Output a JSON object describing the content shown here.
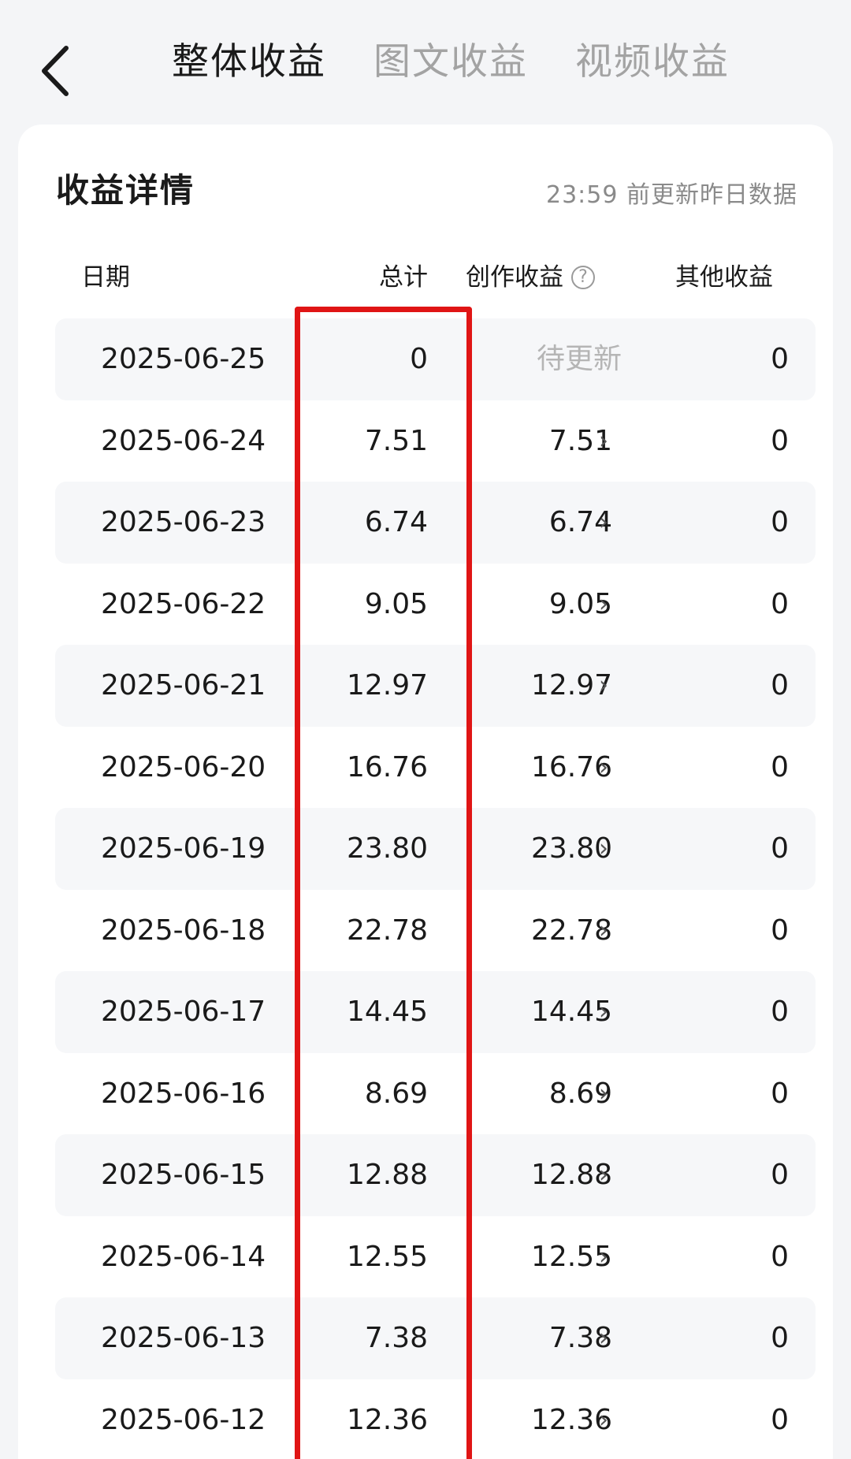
{
  "header": {
    "tabs": [
      {
        "label": "整体收益",
        "active": true
      },
      {
        "label": "图文收益",
        "active": false
      },
      {
        "label": "视频收益",
        "active": false
      }
    ]
  },
  "card": {
    "title": "收益详情",
    "update_note": "23:59 前更新昨日数据",
    "columns": {
      "date": "日期",
      "total": "总计",
      "creation": "创作收益",
      "other": "其他收益"
    },
    "rows": [
      {
        "date": "2025-06-25",
        "total": "0",
        "creation": "待更新",
        "other": "0"
      },
      {
        "date": "2025-06-24",
        "total": "7.51",
        "creation": "7.51",
        "other": "0"
      },
      {
        "date": "2025-06-23",
        "total": "6.74",
        "creation": "6.74",
        "other": "0"
      },
      {
        "date": "2025-06-22",
        "total": "9.05",
        "creation": "9.05",
        "other": "0"
      },
      {
        "date": "2025-06-21",
        "total": "12.97",
        "creation": "12.97",
        "other": "0"
      },
      {
        "date": "2025-06-20",
        "total": "16.76",
        "creation": "16.76",
        "other": "0"
      },
      {
        "date": "2025-06-19",
        "total": "23.80",
        "creation": "23.80",
        "other": "0"
      },
      {
        "date": "2025-06-18",
        "total": "22.78",
        "creation": "22.78",
        "other": "0"
      },
      {
        "date": "2025-06-17",
        "total": "14.45",
        "creation": "14.45",
        "other": "0"
      },
      {
        "date": "2025-06-16",
        "total": "8.69",
        "creation": "8.69",
        "other": "0"
      },
      {
        "date": "2025-06-15",
        "total": "12.88",
        "creation": "12.88",
        "other": "0"
      },
      {
        "date": "2025-06-14",
        "total": "12.55",
        "creation": "12.55",
        "other": "0"
      },
      {
        "date": "2025-06-13",
        "total": "7.38",
        "creation": "7.38",
        "other": "0"
      },
      {
        "date": "2025-06-12",
        "total": "12.36",
        "creation": "12.36",
        "other": "0"
      }
    ]
  },
  "icons": {
    "back": "chevron-left-icon",
    "help": "question-circle-icon",
    "row_chevron": "chevron-right-icon"
  },
  "colors": {
    "highlight": "#e01515",
    "pending": "#b5b5b5",
    "inactive_tab": "#a3a3a3"
  }
}
